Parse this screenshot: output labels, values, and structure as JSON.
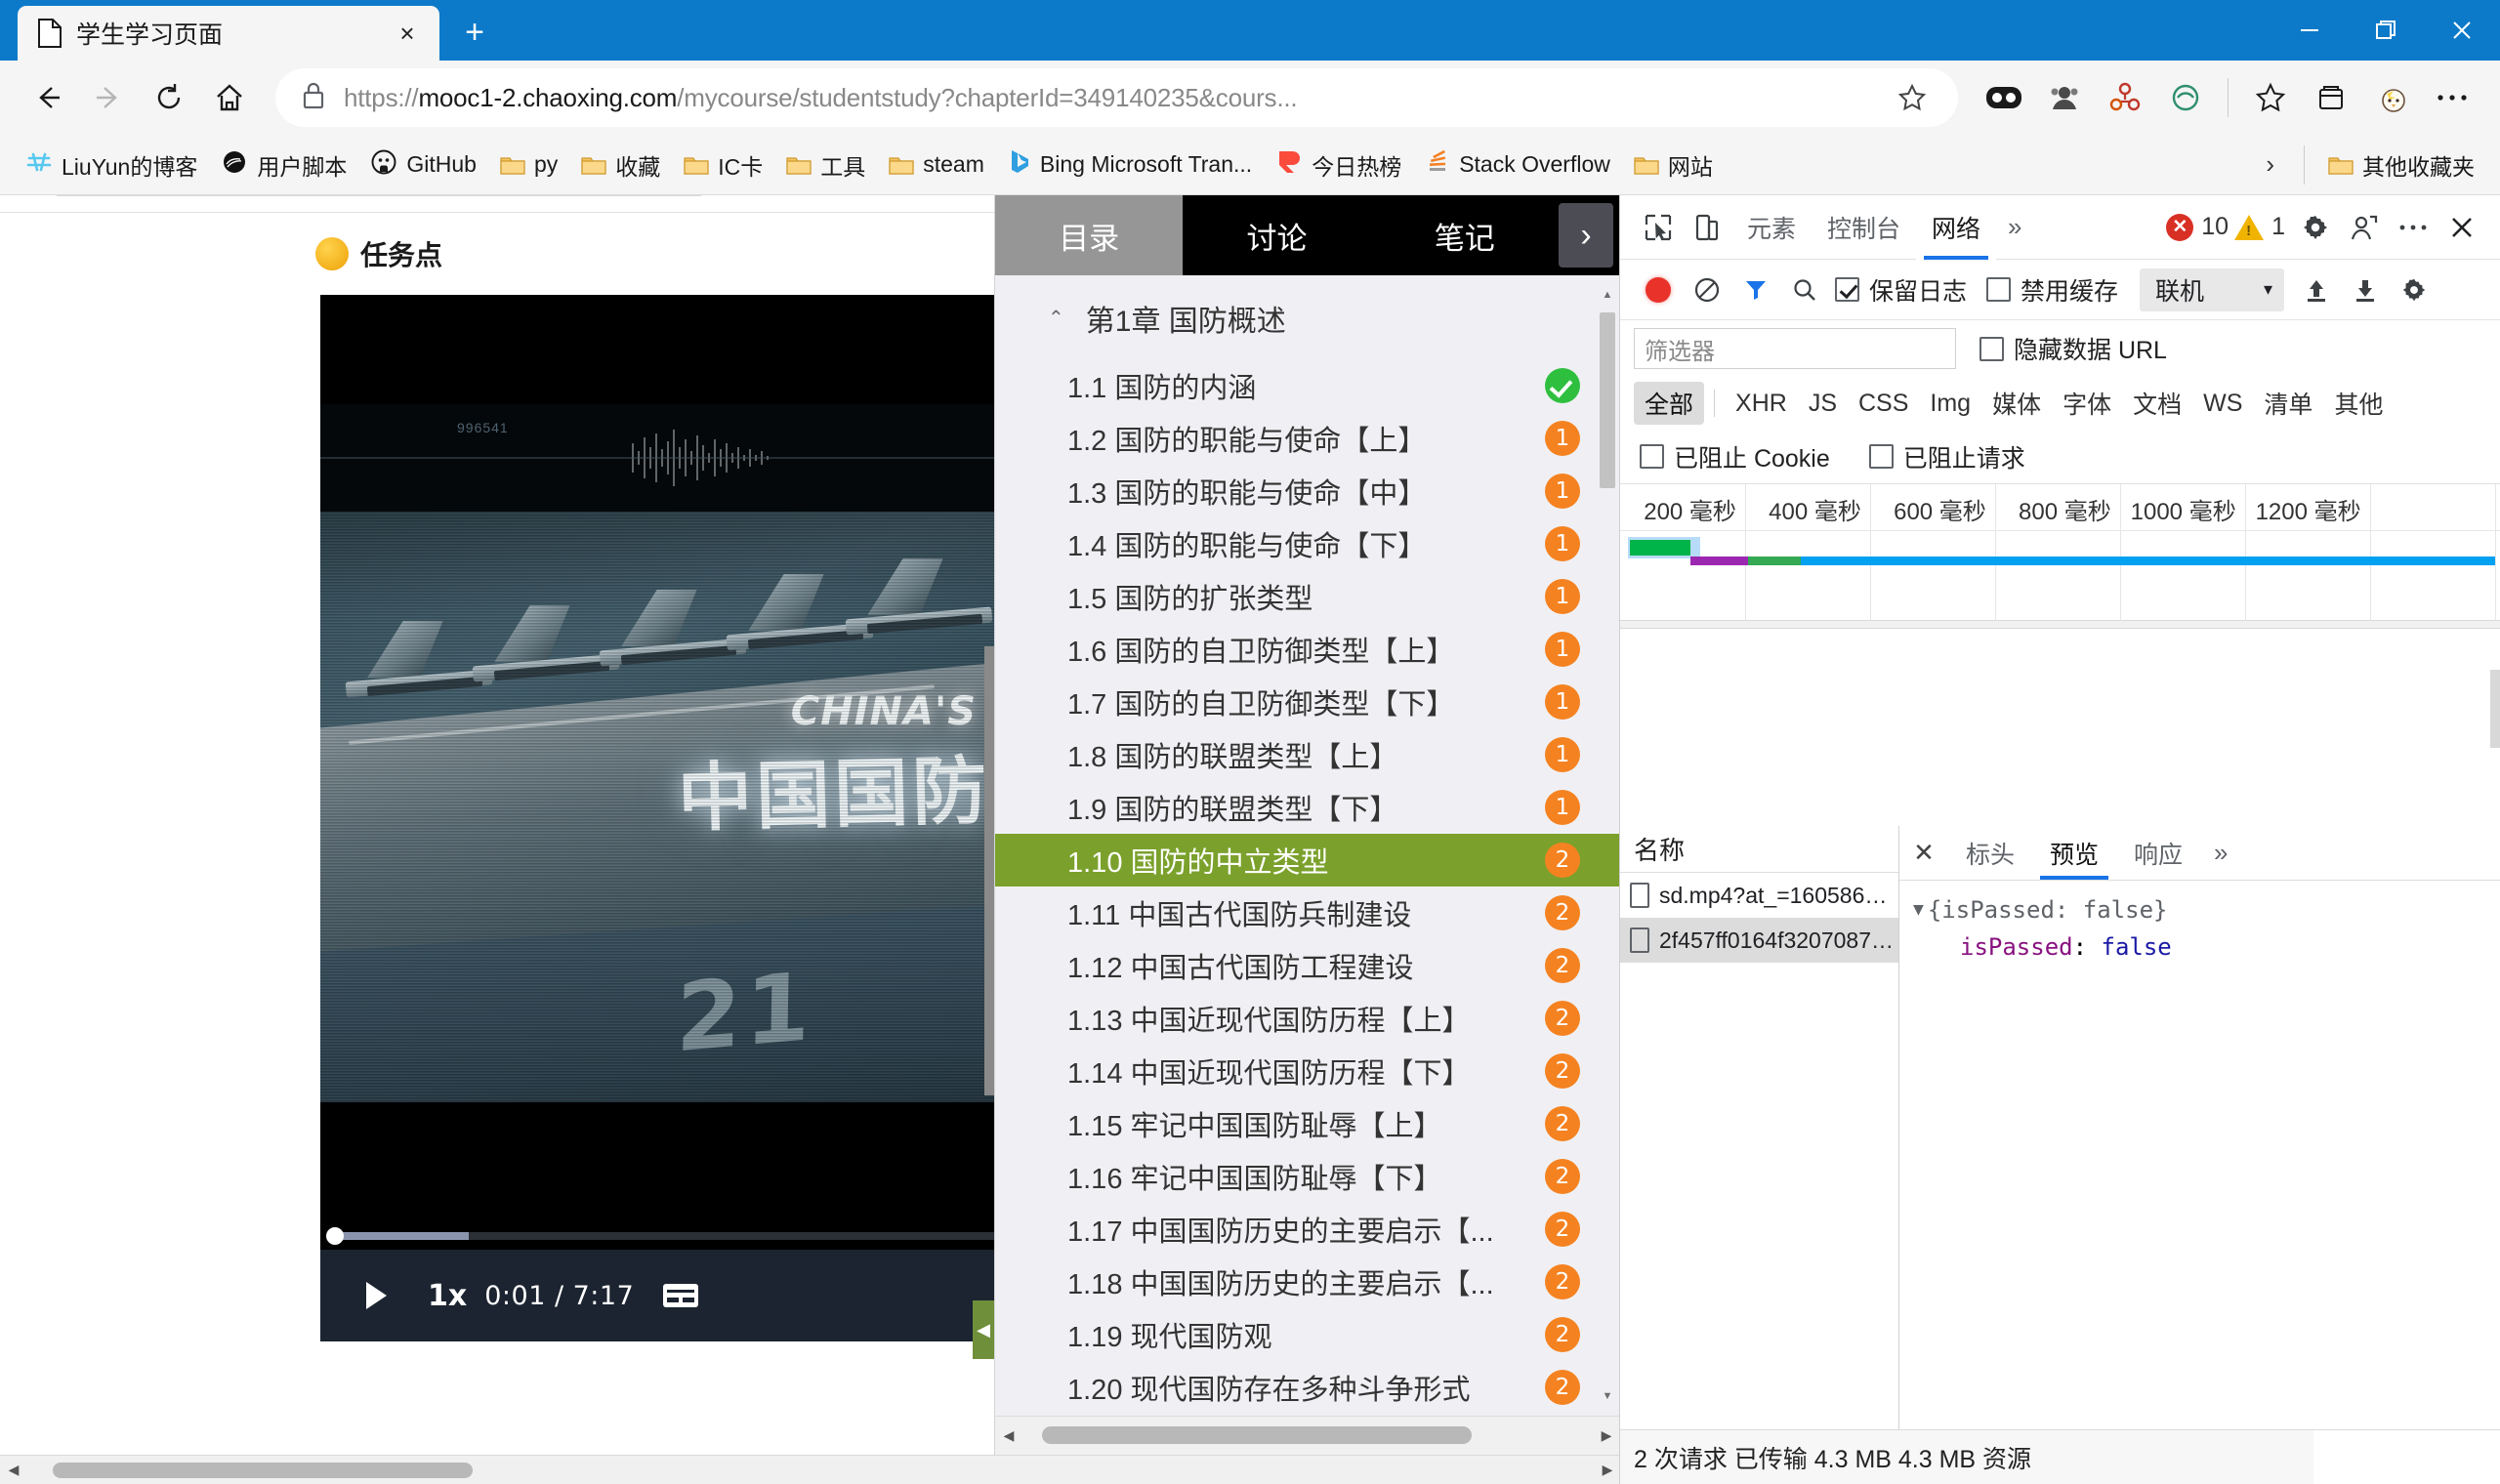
{
  "browser": {
    "tab": {
      "title": "学生学习页面",
      "favicon": "page-icon",
      "close": "×"
    },
    "newtab_label": "+",
    "window_controls": {
      "minimize": "—",
      "maximize": "❐",
      "close": "✕"
    },
    "nav": {
      "back": "←",
      "forward": "→",
      "reload": "↻",
      "home": "⌂"
    },
    "omnibox": {
      "lock": "lock-icon",
      "url_prefix": "https://",
      "url_host": "mooc1-2.chaoxing.com",
      "url_path": "/mycourse/studentstudy?chapterId=349140235&cours...",
      "star": "☆"
    },
    "toolbar_icons": [
      "collections-icon",
      "profile-icon",
      "extensions-icon",
      "shield-icon",
      "favorites-icon",
      "collections2-icon",
      "split-icon",
      "more-icon"
    ]
  },
  "bookmarks": {
    "items": [
      {
        "label": "LiuYun的博客",
        "icon": "cloud-icon"
      },
      {
        "label": "用户脚本",
        "icon": "tampermonkey-icon"
      },
      {
        "label": "GitHub",
        "icon": "github-icon"
      },
      {
        "label": "py",
        "icon": "folder-icon"
      },
      {
        "label": "收藏",
        "icon": "folder-icon"
      },
      {
        "label": "IC卡",
        "icon": "folder-icon"
      },
      {
        "label": "工具",
        "icon": "folder-icon"
      },
      {
        "label": "steam",
        "icon": "folder-icon"
      },
      {
        "label": "Bing Microsoft Tran...",
        "icon": "bing-icon"
      },
      {
        "label": "今日热榜",
        "icon": "rebang-icon"
      },
      {
        "label": "Stack Overflow",
        "icon": "stackoverflow-icon"
      },
      {
        "label": "网站",
        "icon": "folder-icon"
      }
    ],
    "overflow": "›",
    "other": {
      "label": "其他收藏夹",
      "icon": "folder-icon"
    }
  },
  "page": {
    "task_point_label": "任务点",
    "video": {
      "title_en": "CHINA'S",
      "title_cn": "中国国防",
      "hull_number": "21",
      "wave_code": "996541",
      "play_label": "▶",
      "rate": "1x",
      "time": "0:01 / 7:17",
      "cc": "captions-icon"
    }
  },
  "course": {
    "tabs": [
      {
        "label": "目录",
        "active": true
      },
      {
        "label": "讨论",
        "active": false
      },
      {
        "label": "笔记",
        "active": false
      }
    ],
    "next_arrow": "›",
    "chapter": {
      "caret": "⌃",
      "title": "第1章 国防概述"
    },
    "items": [
      {
        "label": "1.1 国防的内涵",
        "badge": "✓",
        "done": true,
        "active": false
      },
      {
        "label": "1.2 国防的职能与使命【上】",
        "badge": "1",
        "done": false,
        "active": false
      },
      {
        "label": "1.3 国防的职能与使命【中】",
        "badge": "1",
        "done": false,
        "active": false
      },
      {
        "label": "1.4 国防的职能与使命【下】",
        "badge": "1",
        "done": false,
        "active": false
      },
      {
        "label": "1.5 国防的扩张类型",
        "badge": "1",
        "done": false,
        "active": false
      },
      {
        "label": "1.6 国防的自卫防御类型【上】",
        "badge": "1",
        "done": false,
        "active": false
      },
      {
        "label": "1.7 国防的自卫防御类型【下】",
        "badge": "1",
        "done": false,
        "active": false
      },
      {
        "label": "1.8 国防的联盟类型【上】",
        "badge": "1",
        "done": false,
        "active": false
      },
      {
        "label": "1.9 国防的联盟类型【下】",
        "badge": "1",
        "done": false,
        "active": false
      },
      {
        "label": "1.10 国防的中立类型",
        "badge": "2",
        "done": false,
        "active": true
      },
      {
        "label": "1.11 中国古代国防兵制建设",
        "badge": "2",
        "done": false,
        "active": false
      },
      {
        "label": "1.12 中国古代国防工程建设",
        "badge": "2",
        "done": false,
        "active": false
      },
      {
        "label": "1.13 中国近现代国防历程【上】",
        "badge": "2",
        "done": false,
        "active": false
      },
      {
        "label": "1.14 中国近现代国防历程【下】",
        "badge": "2",
        "done": false,
        "active": false
      },
      {
        "label": "1.15 牢记中国国防耻辱【上】",
        "badge": "2",
        "done": false,
        "active": false
      },
      {
        "label": "1.16 牢记中国国防耻辱【下】",
        "badge": "2",
        "done": false,
        "active": false
      },
      {
        "label": "1.17 中国国防历史的主要启示【...",
        "badge": "2",
        "done": false,
        "active": false
      },
      {
        "label": "1.18 中国国防历史的主要启示【...",
        "badge": "2",
        "done": false,
        "active": false
      },
      {
        "label": "1.19 现代国防观",
        "badge": "2",
        "done": false,
        "active": false
      },
      {
        "label": "1.20 现代国防存在多种斗争形式",
        "badge": "2",
        "done": false,
        "active": false
      }
    ]
  },
  "devtools": {
    "top": {
      "inspect_icon": "inspect-icon",
      "device_icon": "device-toolbar-icon",
      "tabs": [
        {
          "label": "元素",
          "active": false
        },
        {
          "label": "控制台",
          "active": false
        },
        {
          "label": "网络",
          "active": true
        }
      ],
      "more": "»",
      "errors": "10",
      "warnings": "1",
      "settings_icon": "gear-icon",
      "account_icon": "account-icon",
      "kebab_icon": "more-vertical-icon",
      "close_icon": "close-icon"
    },
    "network_toolbar": {
      "record_icon": "record-icon",
      "clear_icon": "clear-icon",
      "filter_icon": "filter-icon",
      "search_icon": "search-icon",
      "preserve_log": {
        "label": "保留日志",
        "checked": true
      },
      "disable_cache": {
        "label": "禁用缓存",
        "checked": false
      },
      "throttle": {
        "value": "联机",
        "caret": "▾"
      },
      "import_icon": "upload-icon",
      "export_icon": "download-icon",
      "settings_icon": "gear-icon"
    },
    "filters": {
      "input_placeholder": "筛选器",
      "hide_data_urls": {
        "label": "隐藏数据 URL",
        "checked": false
      },
      "types": [
        "全部",
        "XHR",
        "JS",
        "CSS",
        "Img",
        "媒体",
        "字体",
        "文档",
        "WS",
        "清单",
        "其他"
      ],
      "active_type": "全部",
      "blocked_cookies": {
        "label": "已阻止 Cookie",
        "checked": false
      },
      "blocked_requests": {
        "label": "已阻止请求",
        "checked": false
      }
    },
    "timeline": {
      "ticks": [
        "200 毫秒",
        "400 毫秒",
        "600 毫秒",
        "800 毫秒",
        "1000 毫秒",
        "1200 毫秒"
      ],
      "segments": [
        {
          "color": "#00b44a",
          "start_pct": 0.5,
          "width_pct": 7.5
        },
        {
          "color": "#9c27b0",
          "start_pct": 8.0,
          "width_pct": 6.5
        },
        {
          "color": "#34a853",
          "start_pct": 14.5,
          "width_pct": 6.0
        },
        {
          "color": "#00a1f1",
          "start_pct": 20.5,
          "width_pct": 79.0
        }
      ]
    },
    "requests": {
      "column_header": "名称",
      "rows": [
        {
          "name": "sd.mp4?at_=1605864301047&...",
          "selected": false
        },
        {
          "name": "2f457ff0164f3207087e8803c58...",
          "selected": true
        }
      ]
    },
    "detail": {
      "close": "✕",
      "tabs": [
        {
          "label": "标头",
          "active": false
        },
        {
          "label": "预览",
          "active": true
        },
        {
          "label": "响应",
          "active": false
        }
      ],
      "more": "»",
      "preview": {
        "triangle": "▼",
        "summary": "{isPassed: false}",
        "key": "isPassed",
        "colon": ": ",
        "value": "false"
      }
    },
    "status": "2 次请求  已传输 4.3 MB  4.3 MB 资源"
  },
  "colors": {
    "accent_blue": "#0c7ac9",
    "active_green": "#7ba12c",
    "badge_orange": "#f58220",
    "done_green": "#2fbf3f",
    "devtools_blue": "#1a73e8"
  }
}
